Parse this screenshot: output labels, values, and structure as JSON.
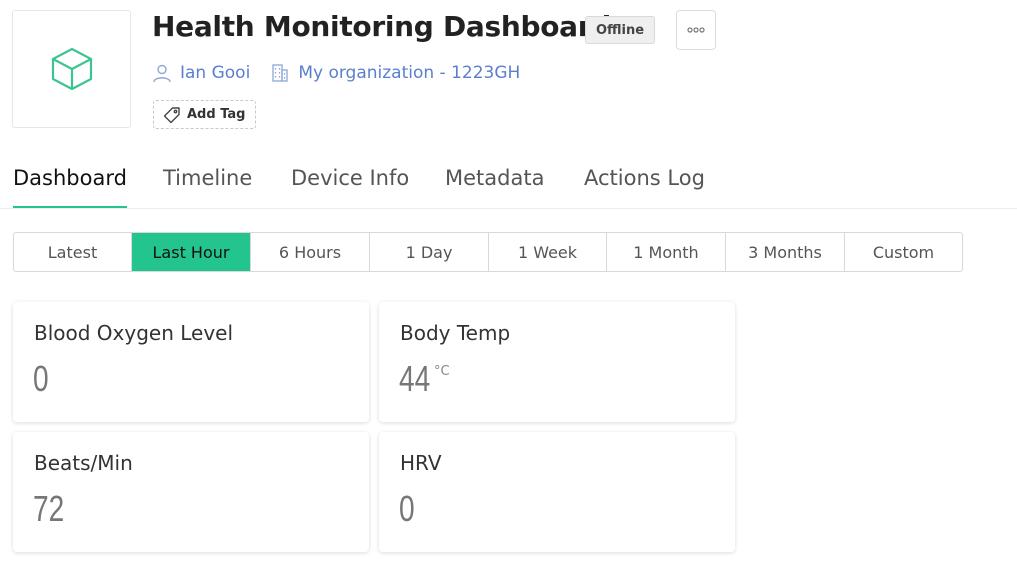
{
  "header": {
    "title": "Health Monitoring Dashboard",
    "status": "Offline",
    "owner": "Ian Gooi",
    "organization": "My organization - 1223GH",
    "add_tag_label": "Add Tag",
    "device_icon": "cube-icon",
    "more_icon": "more-dots-icon"
  },
  "tabs": [
    {
      "label": "Dashboard",
      "active": true
    },
    {
      "label": "Timeline",
      "active": false
    },
    {
      "label": "Device Info",
      "active": false
    },
    {
      "label": "Metadata",
      "active": false
    },
    {
      "label": "Actions Log",
      "active": false
    }
  ],
  "time_range": {
    "options": [
      "Latest",
      "Last Hour",
      "6 Hours",
      "1 Day",
      "1 Week",
      "1 Month",
      "3 Months",
      "Custom"
    ],
    "selected": "Last Hour"
  },
  "widgets": [
    {
      "title": "Blood Oxygen Level",
      "value": "0",
      "unit": ""
    },
    {
      "title": "Body Temp",
      "value": "44",
      "unit": "°C"
    },
    {
      "title": "Beats/Min",
      "value": "72",
      "unit": ""
    },
    {
      "title": "HRV",
      "value": "0",
      "unit": ""
    }
  ],
  "colors": {
    "accent": "#23c48e",
    "link": "#5b7fcf",
    "cube_icon": "#3cc491"
  }
}
